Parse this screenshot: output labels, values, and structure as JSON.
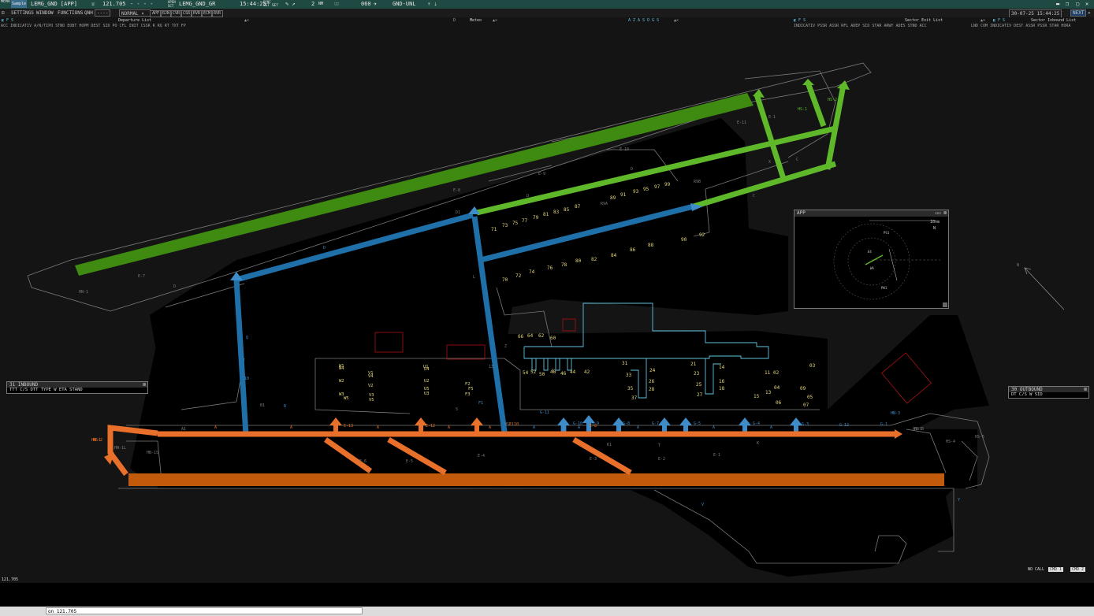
{
  "topbar": {
    "menu_label": "MENU",
    "sector_tag": "Sample",
    "callsign": "LEMG_GND [APP]",
    "frequency": "121.705",
    "dashes": "-   -   -   -",
    "open_label": "OPEN",
    "sct_label": "SCT",
    "sector_name": "LEMG_GND_GR",
    "time": "15:44:25",
    "sync_label": "SYNC",
    "set_label": "SET SET",
    "rng_value": "2",
    "nm_label": "NM",
    "alt_value": "060",
    "level_filter": "GND-UNL"
  },
  "menubar": {
    "settings": "SETTINGS",
    "window": "WINDOW",
    "functions": "FUNCTIONS",
    "qnh_label": "QNH",
    "qnh_value": "----",
    "mode": "NORMAL",
    "toggles": [
      "APP",
      "RJN",
      "CVR",
      "CSR",
      "RVR",
      "ECM",
      "RVR"
    ],
    "datetime": "30-07-25 15:44:25"
  },
  "lists": {
    "departure_title": "Departure List",
    "departure_header": "ACC INDICATIV A/N/TIPO STND EOBT HOPM DEST   SID    PO   CFL  INIT CSSR R RQ RT    TXT     FP",
    "meteo_title": "Meteo",
    "center_title": "A Z A S D G S",
    "sector_exit_title": "Sector Exit List",
    "sector_exit_header": "INDICATIV PSSR ASSR  RFL  ADEP   SID      STAR  ARWY ADES STND  ACC",
    "sector_inbound_title": "Sector Inbound List",
    "sector_inbound_header": "LND COM INDICATIV DEST ASSR PSSR   STAR  HORA"
  },
  "inbound": {
    "title": "31 INBOUND",
    "header": "TTT   C/S               DTT TYPE W ETA   STAND"
  },
  "outbound": {
    "title": "30 OUTBOUND",
    "header": "DT    C/S        W SID"
  },
  "app_window": {
    "title": "APP",
    "range": "10nm",
    "north": "N",
    "fixes": [
      "PS1",
      "E4",
      "WA",
      "PW1"
    ]
  },
  "map": {
    "stands_top": [
      "89",
      "91",
      "93",
      "95",
      "97",
      "99",
      "71",
      "73",
      "75",
      "77",
      "79",
      "81",
      "83",
      "85",
      "87",
      "70",
      "72",
      "74",
      "76",
      "78",
      "80",
      "82",
      "84",
      "86",
      "88",
      "90",
      "92"
    ],
    "stands_mid": [
      "66",
      "64",
      "62",
      "60",
      "54",
      "52",
      "50",
      "48",
      "46",
      "44",
      "42",
      "31",
      "33",
      "35",
      "37",
      "24",
      "26",
      "28",
      "21",
      "23",
      "25",
      "27",
      "14",
      "16",
      "18",
      "11",
      "02",
      "03",
      "04",
      "09",
      "05",
      "07",
      "13",
      "15",
      "06"
    ],
    "stands_w": [
      "W1",
      "W2",
      "W3",
      "W4",
      "W5",
      "V1",
      "V2",
      "V3",
      "V4",
      "V5",
      "U1",
      "U2",
      "U3",
      "U4",
      "U5",
      "F2",
      "F3",
      "F5"
    ],
    "taxi_labels": [
      "A",
      "A",
      "A",
      "A",
      "A",
      "A",
      "A",
      "A",
      "A",
      "A",
      "A1",
      "E-13",
      "E-12",
      "E-10",
      "E-8",
      "E-6",
      "E-5",
      "E-4",
      "E-3",
      "E-2",
      "E-1",
      "K",
      "K1",
      "D",
      "D",
      "D",
      "D",
      "D1",
      "C",
      "C",
      "X",
      "E-9",
      "E-10",
      "E-11",
      "E-7",
      "E-8",
      "E-1",
      "HS-1",
      "HS-2",
      "HS-3",
      "HS-4",
      "HS-5",
      "HN-1",
      "HN-1L",
      "HN-1S",
      "HN-1",
      "N",
      "L",
      "B1",
      "R9A",
      "R9B",
      "F1",
      "G-1",
      "G-3",
      "G-4",
      "G-5",
      "G-7",
      "G-8",
      "G-9",
      "G-10",
      "G-11",
      "G-12",
      "Q",
      "R",
      "S",
      "T",
      "V",
      "Y",
      "Z",
      "13",
      "12",
      "10",
      "HN-3",
      "HS-1",
      "HS-2",
      "HS-3"
    ]
  },
  "status": {
    "freq_bottom": "121.705",
    "no_call": "NO CALL",
    "btn1": "CMD 1",
    "btn2": "CMD 2"
  },
  "command": {
    "value": "on 121.705",
    "label": ""
  },
  "colors": {
    "runway_green": "#3f8a10",
    "taxi_green": "#5fb82a",
    "taxi_blue": "#1f6fa8",
    "taxi_orange": "#e8702a",
    "runway_orange": "#c25a0c",
    "stand_yellow": "#e6d87a",
    "outline": "#7a7a7a",
    "terminal_cyan": "#5fc4e0"
  }
}
